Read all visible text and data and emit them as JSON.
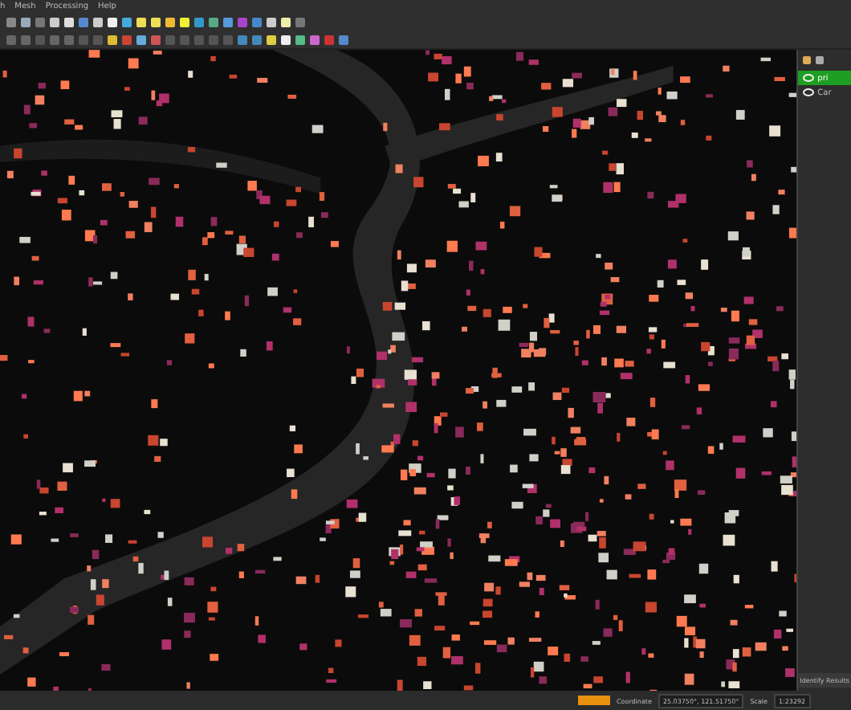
{
  "menu": [
    "h",
    "Mesh",
    "Processing",
    "Help"
  ],
  "layers": [
    {
      "name": "pri",
      "visible": true,
      "selected": true
    },
    {
      "name": "Car",
      "visible": true,
      "selected": false
    }
  ],
  "panel_footer": "Identify Results",
  "status_bar": {
    "coordinate_label": "Coordinate",
    "coordinate": "25.03750°, 121.51750°",
    "scale_label": "Scale",
    "scale": "1:23292"
  }
}
